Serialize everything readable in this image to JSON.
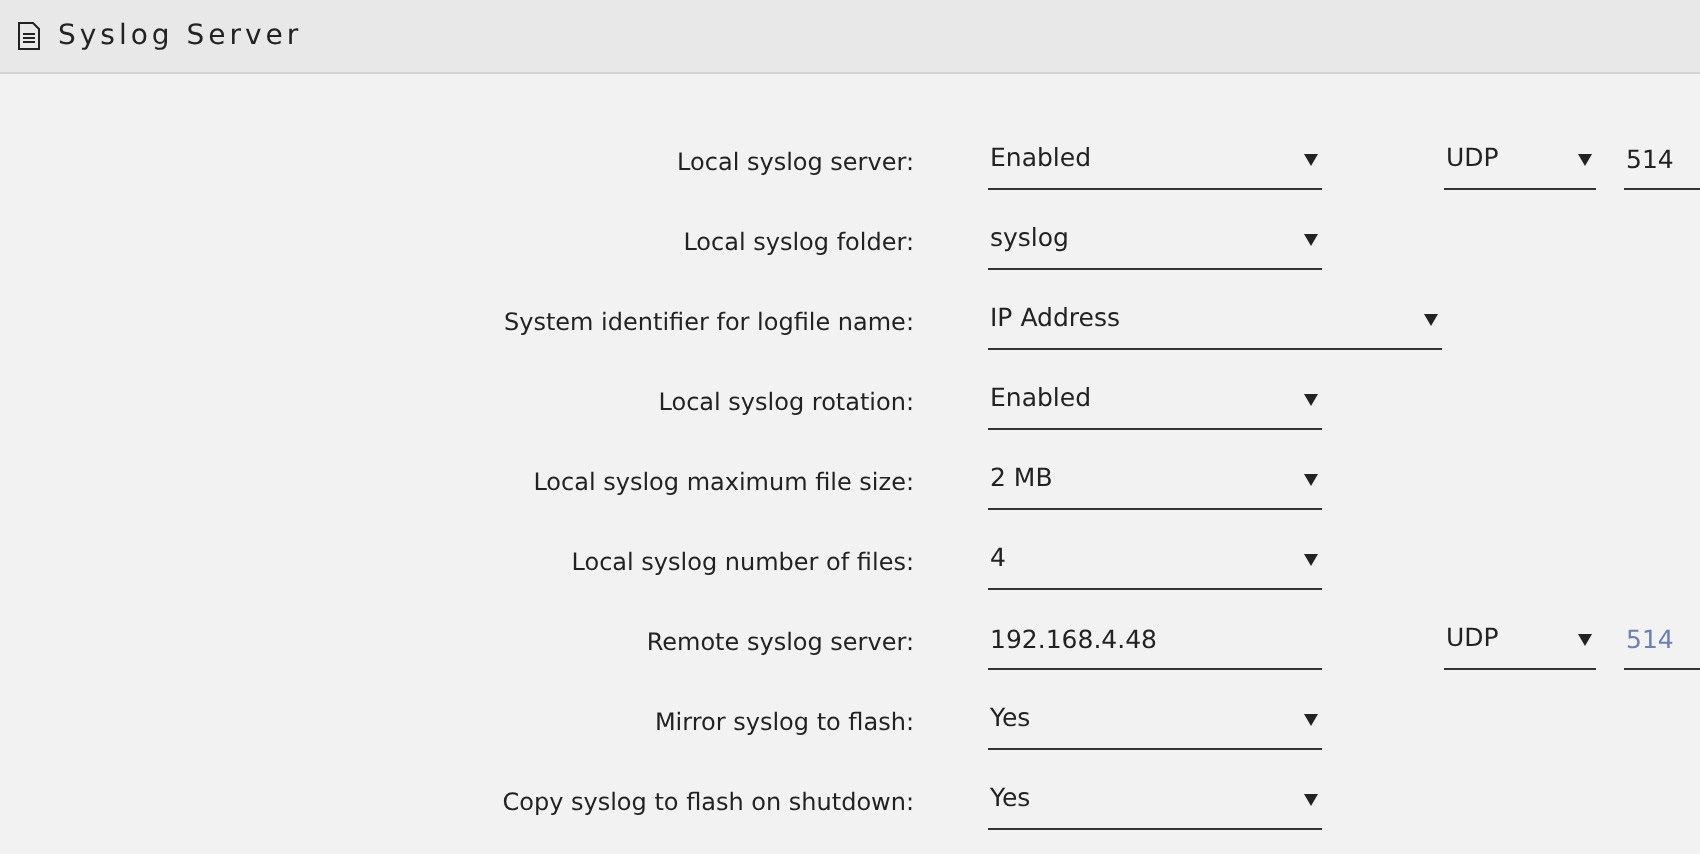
{
  "header": {
    "title": "Syslog Server"
  },
  "rows": [
    {
      "label": "Local syslog server:",
      "controls": [
        {
          "kind": "select",
          "value": "Enabled"
        },
        {
          "kind": "protocol",
          "value": "UDP"
        },
        {
          "kind": "port",
          "value": "514"
        }
      ]
    },
    {
      "label": "Local syslog folder:",
      "controls": [
        {
          "kind": "select",
          "value": "syslog"
        }
      ]
    },
    {
      "label": "System identifier for logfile name:",
      "controls": [
        {
          "kind": "wideselect",
          "value": "IP Address"
        }
      ]
    },
    {
      "label": "Local syslog rotation:",
      "controls": [
        {
          "kind": "select",
          "value": "Enabled"
        }
      ]
    },
    {
      "label": "Local syslog maximum file size:",
      "controls": [
        {
          "kind": "select",
          "value": "2 MB"
        }
      ]
    },
    {
      "label": "Local syslog number of files:",
      "controls": [
        {
          "kind": "select",
          "value": "4"
        }
      ]
    },
    {
      "label": "Remote syslog server:",
      "controls": [
        {
          "kind": "text",
          "value": "192.168.4.48"
        },
        {
          "kind": "protocol",
          "value": "UDP"
        },
        {
          "kind": "port",
          "placeholder": "514"
        }
      ]
    },
    {
      "label": "Mirror syslog to flash:",
      "controls": [
        {
          "kind": "select",
          "value": "Yes"
        }
      ]
    },
    {
      "label": "Copy syslog to flash on shutdown:",
      "controls": [
        {
          "kind": "select",
          "value": "Yes"
        }
      ]
    }
  ]
}
